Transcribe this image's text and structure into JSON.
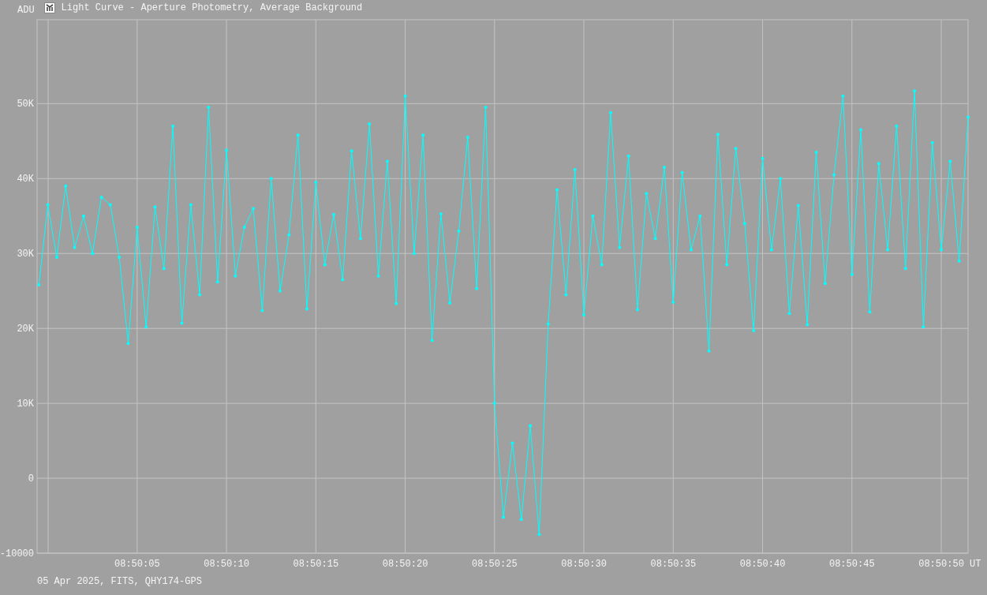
{
  "window": {
    "title": "Light Curve - Aperture Photometry, Average Background"
  },
  "chart": {
    "y_unit": "ADU",
    "x_unit": "UT",
    "chart_data": {
      "type": "line",
      "grid": true,
      "ylim": [
        -10000,
        61200
      ],
      "yticks": [
        {
          "value": 50000,
          "label": "50K"
        },
        {
          "value": 40000,
          "label": "40K"
        },
        {
          "value": 30000,
          "label": "30K"
        },
        {
          "value": 20000,
          "label": "20K"
        },
        {
          "value": 10000,
          "label": "10K"
        },
        {
          "value": 0,
          "label": "0"
        },
        {
          "value": -10000,
          "label": "-10000"
        }
      ],
      "categories": [
        null,
        null,
        null,
        null,
        null,
        null,
        null,
        null,
        null,
        null,
        null,
        "08:50:05",
        null,
        null,
        null,
        null,
        null,
        null,
        null,
        null,
        null,
        "08:50:10",
        null,
        null,
        null,
        null,
        null,
        null,
        null,
        null,
        null,
        "08:50:15",
        null,
        null,
        null,
        null,
        null,
        null,
        null,
        null,
        null,
        "08:50:20",
        null,
        null,
        null,
        null,
        null,
        null,
        null,
        null,
        null,
        "08:50:25",
        null,
        null,
        null,
        null,
        null,
        null,
        null,
        null,
        null,
        "08:50:30",
        null,
        null,
        null,
        null,
        null,
        null,
        null,
        null,
        null,
        "08:50:35",
        null,
        null,
        null,
        null,
        null,
        null,
        null,
        null,
        null,
        "08:50:40",
        null,
        null,
        null,
        null,
        null,
        null,
        null,
        null,
        null,
        "08:50:45",
        null,
        null,
        null,
        null,
        null,
        null,
        null,
        null,
        null,
        "08:50:50",
        null,
        null,
        null
      ],
      "series": [
        {
          "color": "#00ffff",
          "values": [
            25800,
            36500,
            29500,
            39000,
            30800,
            35000,
            30000,
            37500,
            36500,
            29500,
            18000,
            33500,
            20200,
            36200,
            28000,
            47000,
            20700,
            36500,
            24500,
            49500,
            26200,
            43800,
            27000,
            33500,
            36000,
            22400,
            40000,
            25000,
            32500,
            45800,
            22600,
            39500,
            28500,
            35200,
            26500,
            43700,
            32000,
            47300,
            27000,
            42300,
            23300,
            51000,
            30000,
            45800,
            18400,
            35300,
            23400,
            33000,
            45500,
            25300,
            49500,
            10000,
            -5200,
            4700,
            -5500,
            7000,
            -7500,
            20600,
            38500,
            24500,
            41200,
            21800,
            35000,
            28500,
            48800,
            30800,
            43000,
            22500,
            38000,
            32000,
            41500,
            23500,
            40800,
            30500,
            35000,
            17000,
            45900,
            28500,
            44000,
            34000,
            19700,
            42700,
            30500,
            40000,
            22000,
            36400,
            20500,
            43500,
            26000,
            40500,
            51000,
            27200,
            46500,
            22200,
            42000,
            30500,
            47000,
            28000,
            51700,
            20200,
            44800,
            30500,
            42300,
            29000,
            48200
          ]
        }
      ]
    }
  },
  "status_bar": {
    "text": "05 Apr 2025, FITS, QHY174-GPS"
  }
}
